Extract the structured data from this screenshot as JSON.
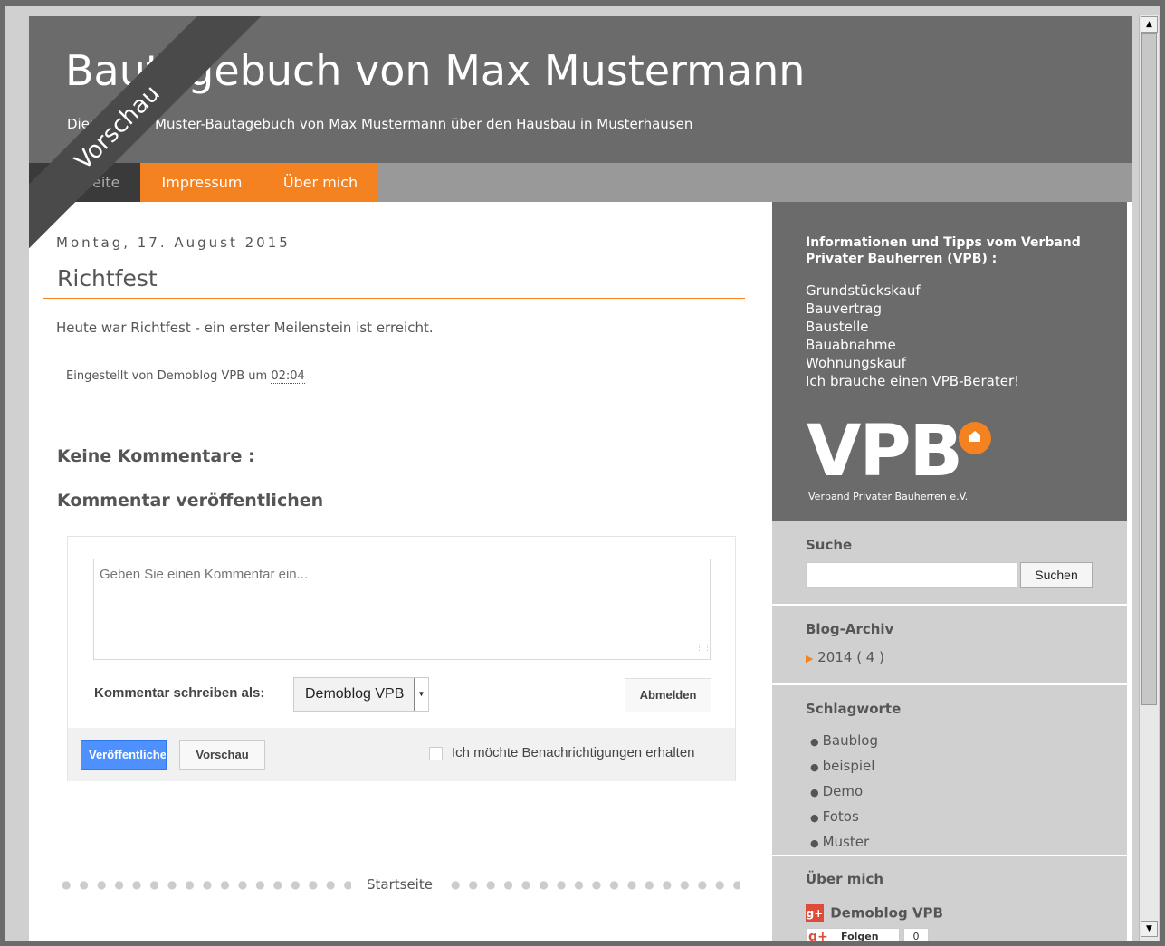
{
  "header": {
    "title": "Bautagebuch von Max Mustermann",
    "description": "Dies ist eine Muster-Bautagebuch von Max Mustermann über den Hausbau in Musterhausen",
    "preview_ribbon": "Vorschau"
  },
  "tabs": [
    {
      "label": "Startseite",
      "active": true
    },
    {
      "label": "Impressum",
      "active": false
    },
    {
      "label": "Über mich",
      "active": false
    }
  ],
  "post": {
    "date": "Montag, 17. August 2015",
    "title": "Richtfest",
    "body": "Heute war Richtfest - ein erster Meilenstein ist erreicht.",
    "footer_prefix": "Eingestellt von Demoblog VPB um",
    "time": "02:04"
  },
  "comments": {
    "count_label": "Keine Kommentare :",
    "form_heading": "Kommentar veröffentlichen",
    "placeholder": "Geben Sie einen Kommentar ein...",
    "write_as_label": "Kommentar schreiben als:",
    "identity": "Demoblog VPB",
    "signout_label": "Abmelden",
    "publish_label": "Veröffentlichen",
    "preview_label": "Vorschau",
    "notify_label": "Ich möchte Benachrichtigungen erhalten"
  },
  "footer": {
    "home_link": "Startseite"
  },
  "sidebar": {
    "info_title": "Informationen und Tipps vom Verband Privater Bauherren (VPB) :",
    "links": [
      "Grundstückskauf",
      "Bauvertrag",
      "Baustelle",
      "Bauabnahme",
      "Wohnungskauf",
      "Ich brauche einen VPB-Berater!"
    ],
    "logo_text": "VPB",
    "logo_caption": "Verband Privater Bauherren e.V.",
    "search_title": "Suche",
    "search_button": "Suchen",
    "archive_title": "Blog-Archiv",
    "archive_item": "2014 ( 4 )",
    "tags_title": "Schlagworte",
    "tags": [
      "Baublog",
      "beispiel",
      "Demo",
      "Fotos",
      "Muster"
    ],
    "about_title": "Über mich",
    "profile_name": "Demoblog VPB",
    "follow_label": "Folgen",
    "follow_count": "0"
  },
  "colors": {
    "accent": "#f58220",
    "header_bg": "#6b6b6b",
    "sidebar_bg": "#d0d0d0",
    "publish_blue": "#4d90fe"
  }
}
